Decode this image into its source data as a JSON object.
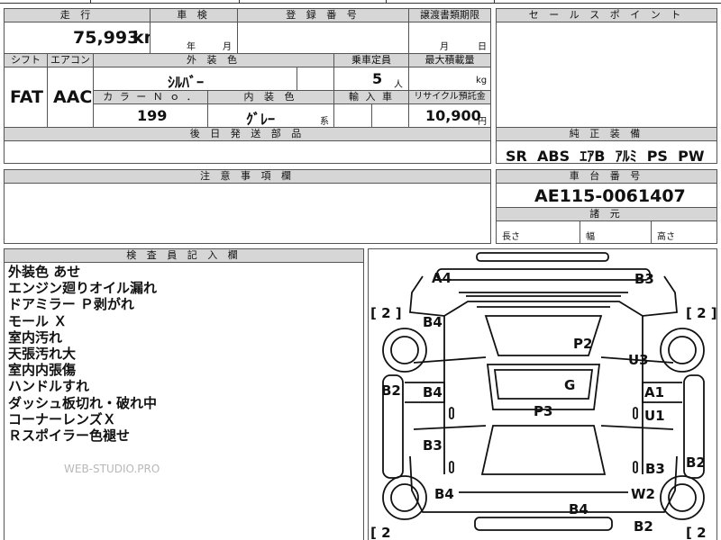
{
  "sheet": {
    "headers": {
      "mileage": "走 行",
      "inspection": "車 検",
      "registration": "登 録 番 号",
      "transfer_deadline": "譲渡書類期限",
      "sales_point": "セ ー ル ス ポ イ ン ト",
      "shift": "シフト",
      "aircon": "エアコン",
      "exterior_color": "外 装 色",
      "capacity": "乗車定員",
      "max_load": "最大積載量",
      "color_no": "カ ラ ー Ｎ ｏ ．",
      "interior_color": "内 装 色",
      "import": "輸 入 車",
      "recycle": "リサイクル預託金",
      "later_parts": "後 日 発 送 部 品",
      "equipment": "純 正 装 備",
      "notes": "注 意 事 項 欄",
      "chassis_no": "車 台 番 号",
      "dimensions": "諸 元",
      "inspector": "検 査 員 記 入 欄"
    },
    "values": {
      "mileage": "75,993",
      "mileage_unit": "km",
      "inspection_year": "年",
      "inspection_month": "月",
      "transfer_month": "月",
      "transfer_day": "日",
      "shift": "FAT",
      "aircon": "AAC",
      "exterior_color": "ｼﾙﾊﾞｰ",
      "capacity": "5",
      "capacity_unit": "人",
      "max_load_unit": "kg",
      "color_no": "199",
      "interior_color": "ｸﾞﾚｰ",
      "interior_suffix": "系",
      "recycle": "10,900",
      "recycle_unit": "円",
      "equipment": "SR  ABS  ｴｱB  ｱﾙﾐ  PS  PW",
      "chassis_no": "AE115-0061407",
      "length_label": "長さ",
      "width_label": "幅",
      "height_label": "高さ"
    },
    "inspector_notes": [
      "外装色 あせ",
      "エンジン廻りオイル漏れ",
      "ドアミラー Ｐ剥がれ",
      "モール Ｘ",
      "室内汚れ",
      "天張汚れ大",
      "室内内張傷",
      "ハンドルすれ",
      "ダッシュ板切れ・破れ中",
      "コーナーレンズＸ",
      "Ｒスポイラー色褪せ"
    ],
    "watermark": "WEB-STUDIO.PRO",
    "diagram": {
      "marks": {
        "a4": "A4",
        "b3_top": "B3",
        "b4_left_top": "B4",
        "p2": "P2",
        "u3": "U3",
        "b2_left": "B2",
        "b4_left_mid": "B4",
        "g": "G",
        "a1": "A1",
        "p3": "P3",
        "u1": "U1",
        "b3_left": "B3",
        "b2_right": "B2",
        "b3_right": "B3",
        "b4_left_bottom": "B4",
        "w2": "W2",
        "b4_bottom": "B4",
        "b2_bottom": "B2"
      },
      "brackets": {
        "left_top": "[ 2 ]",
        "right_top": "[ 2 ]",
        "left_bottom": "[ 2",
        "right_bottom": "[ 2"
      }
    }
  }
}
